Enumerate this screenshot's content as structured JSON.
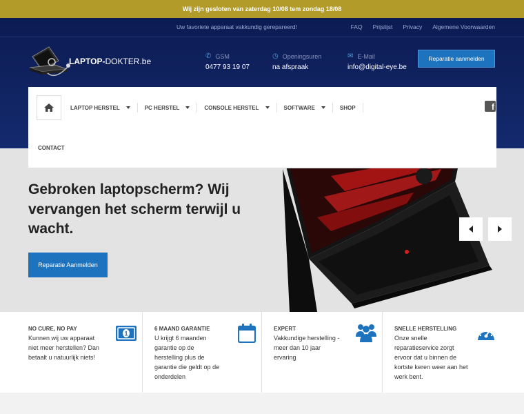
{
  "notice": "Wij zijn gesloten van zaterdag 10/08 tem zondag 18/08",
  "topbar": {
    "tagline": "Uw favoriete apparaat vakkundig gerepareerd!",
    "links": [
      "FAQ",
      "Prijslijst",
      "Privacy",
      "Algemene Voorwaarden"
    ]
  },
  "logo": {
    "bold": "LAPTOP-",
    "rest": "DOKTER.be"
  },
  "contact": {
    "gsm_label": "GSM",
    "gsm_value": "0477 93 19 07",
    "hours_label": "Openingsuren",
    "hours_value": "na afspraak",
    "email_label": "E-Mail",
    "email_value": "info@digital-eye.be"
  },
  "cta_top": "Reparatie aanmelden",
  "nav": {
    "items": [
      "LAPTOP HERSTEL",
      "PC HERSTEL",
      "CONSOLE HERSTEL",
      "SOFTWARE",
      "SHOP"
    ],
    "contact": "CONTACT"
  },
  "hero": {
    "title": "Gebroken laptopscherm? Wij vervangen het scherm terwijl u wacht.",
    "button": "Reparatie Aanmelden"
  },
  "features": [
    {
      "title": "NO CURE, NO PAY",
      "text": "Kunnen wij uw apparaat niet meer herstellen? Dan betaalt u natuurlijk niets!",
      "icon": "money-icon"
    },
    {
      "title": "6 MAAND GARANTIE",
      "text": "U krijgt 6 maanden garantie op de herstelling plus de garantie die geldt op de onderdelen",
      "icon": "calendar-icon"
    },
    {
      "title": "EXPERT",
      "text": "Vakkundige herstelling - meer dan 10 jaar ervaring",
      "icon": "users-icon"
    },
    {
      "title": "SNELLE HERSTELLING",
      "text": "Onze snelle reparatieservice zorgt ervoor dat u binnen de kortste keren weer aan het werk bent.",
      "icon": "speedometer-icon"
    }
  ],
  "colors": {
    "brand": "#1e73be",
    "header": "#0c1b52",
    "notice": "#b39b2a"
  }
}
